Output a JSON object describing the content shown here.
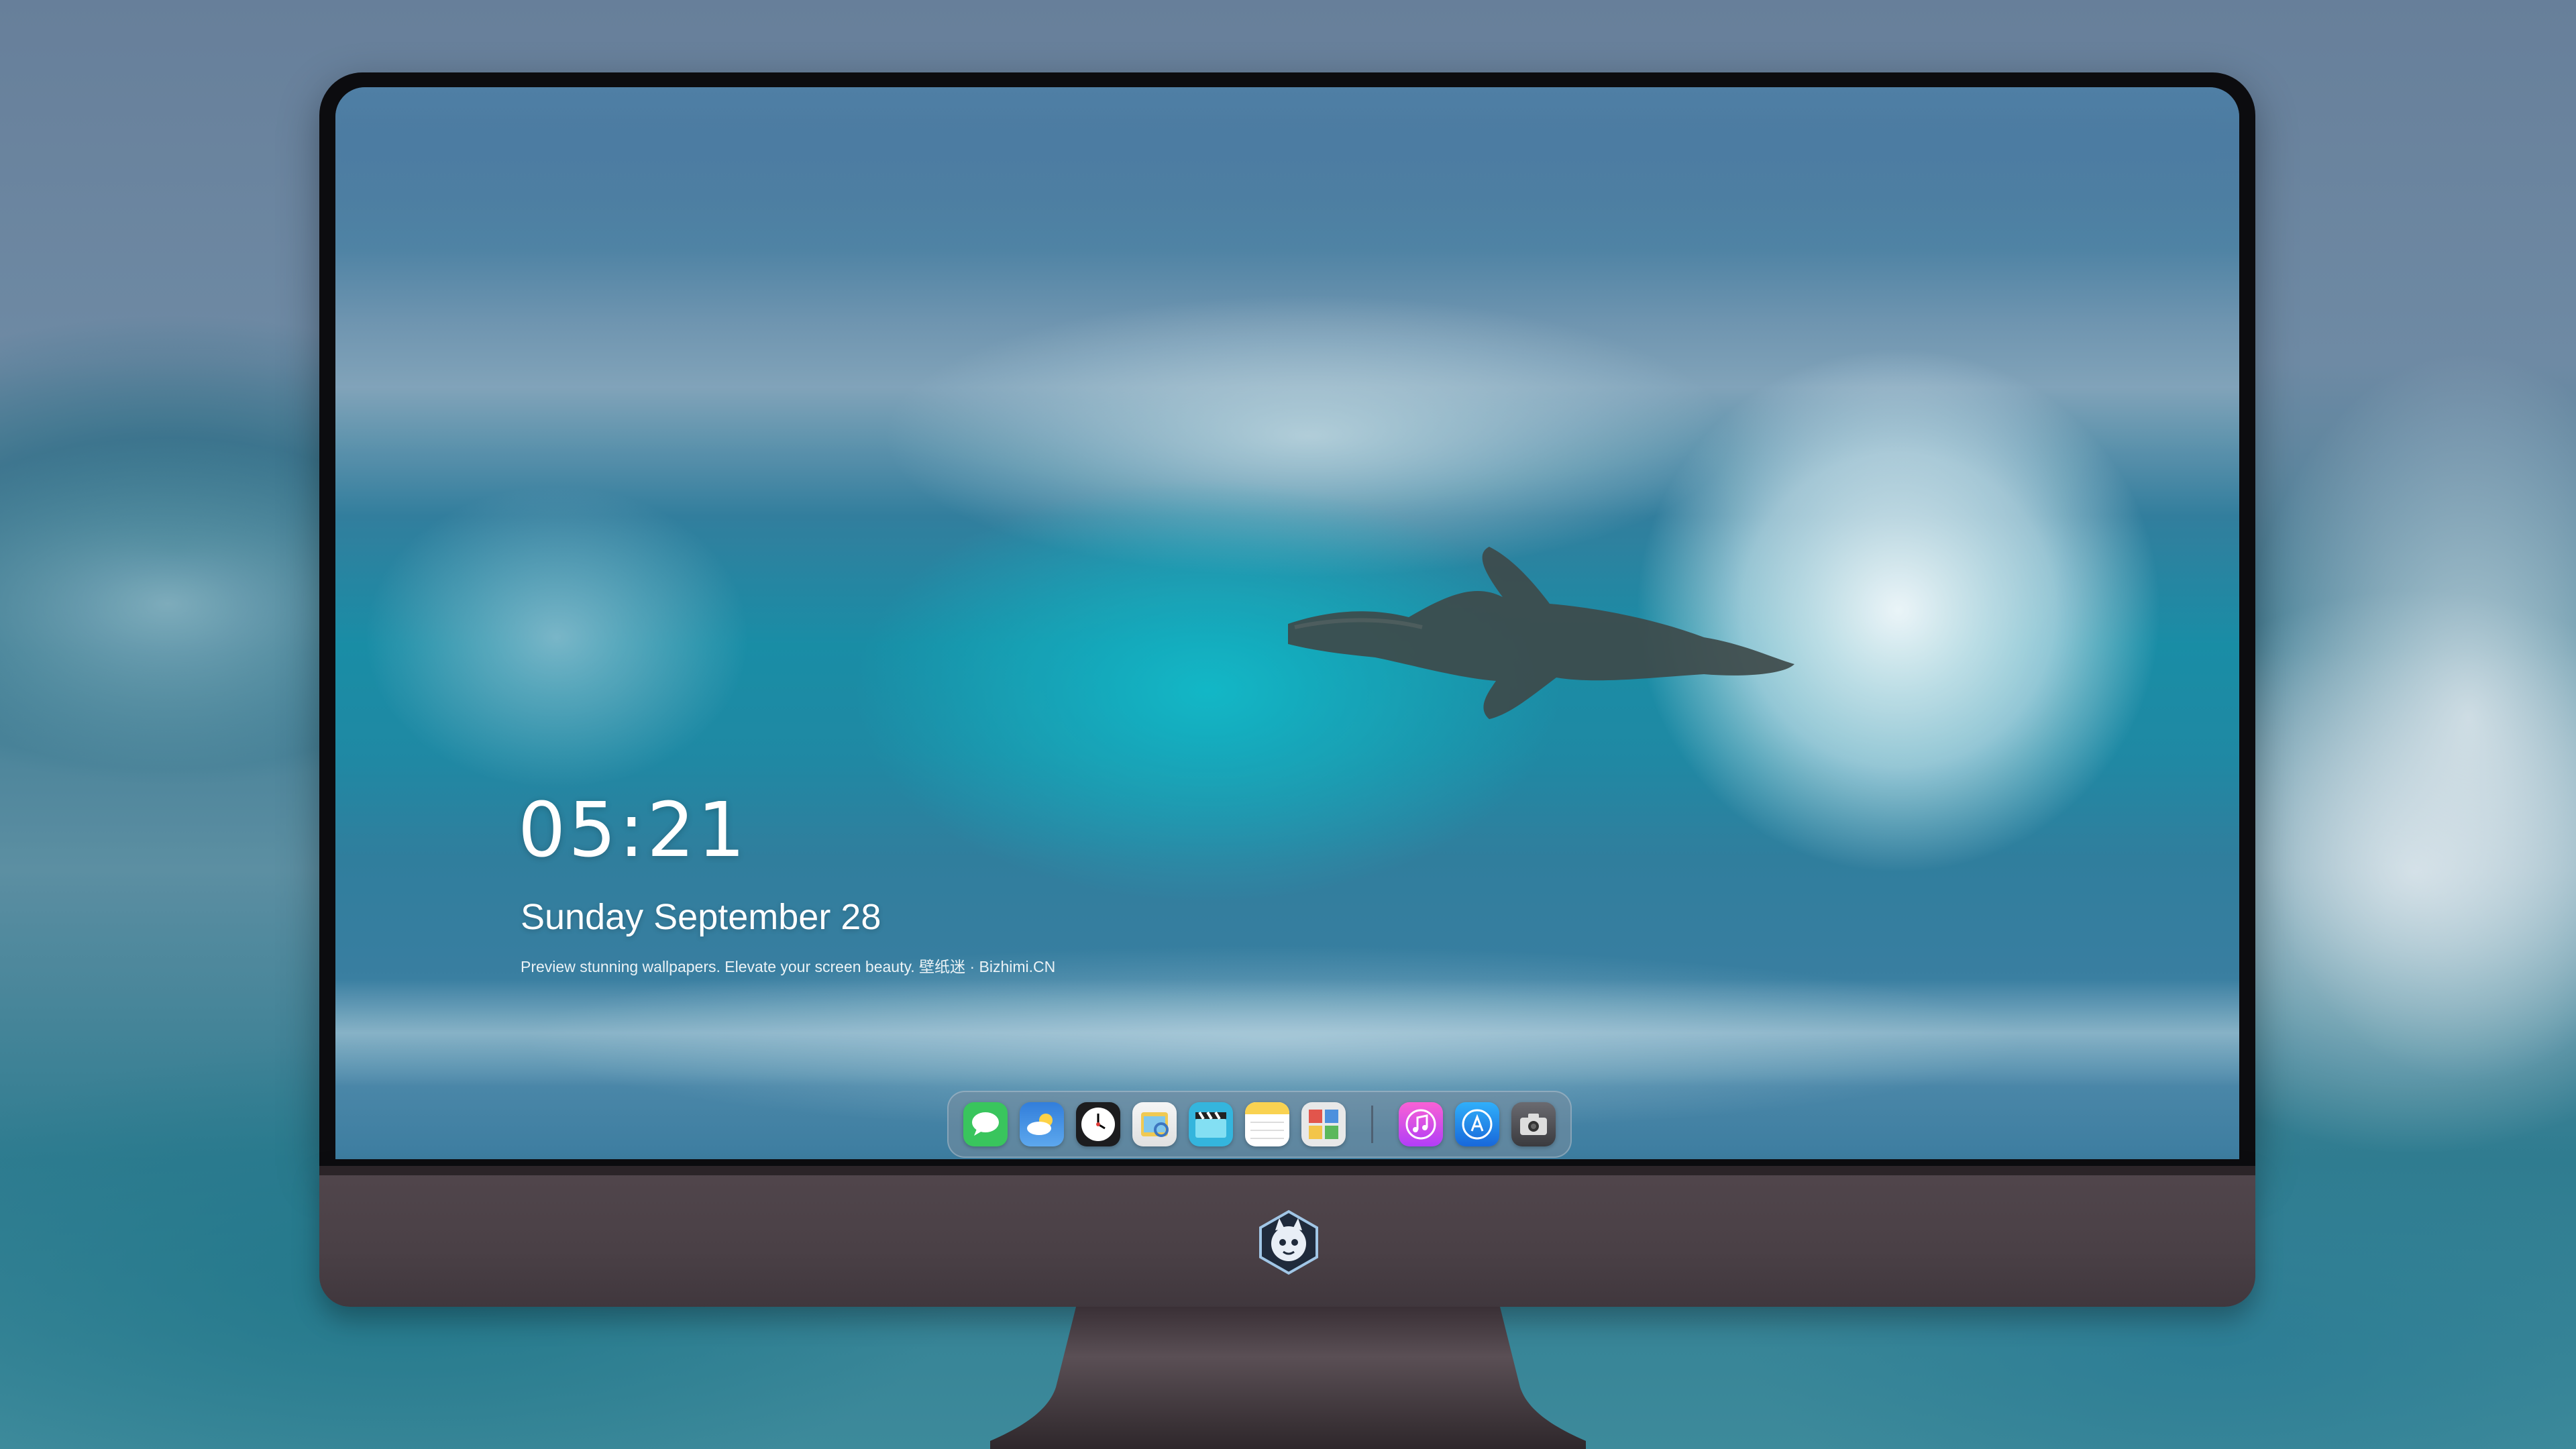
{
  "lock_screen": {
    "time": "05:21",
    "date": "Sunday September   28",
    "caption": "Preview stunning wallpapers. Elevate your screen beauty. 壁纸迷 · Bizhimi.CN"
  },
  "dock": {
    "apps": [
      {
        "name": "Messages",
        "icon": "messages-icon",
        "color": "#34c759"
      },
      {
        "name": "Weather",
        "icon": "weather-icon",
        "color": "#3a8ee6"
      },
      {
        "name": "Clock",
        "icon": "clock-icon",
        "color": "#1c1c1e"
      },
      {
        "name": "Preview",
        "icon": "preview-icon",
        "color": "#f2c94c"
      },
      {
        "name": "Clips",
        "icon": "clips-icon",
        "color": "#2fb6e0"
      },
      {
        "name": "Notes",
        "icon": "notes-icon",
        "color": "#fbd24a"
      },
      {
        "name": "Photo Booth",
        "icon": "photo-booth-icon",
        "color": "#e8e8e8"
      },
      {
        "name": "Music",
        "icon": "music-icon",
        "color": "#e84bd0"
      },
      {
        "name": "App Store",
        "icon": "app-store-icon",
        "color": "#1e88f0"
      },
      {
        "name": "Screenshot",
        "icon": "camera-icon",
        "color": "#4a4a4e"
      }
    ]
  },
  "colors": {
    "bezel": "#0c0c0f",
    "chin": "#4a4046",
    "text": "#ffffff"
  }
}
